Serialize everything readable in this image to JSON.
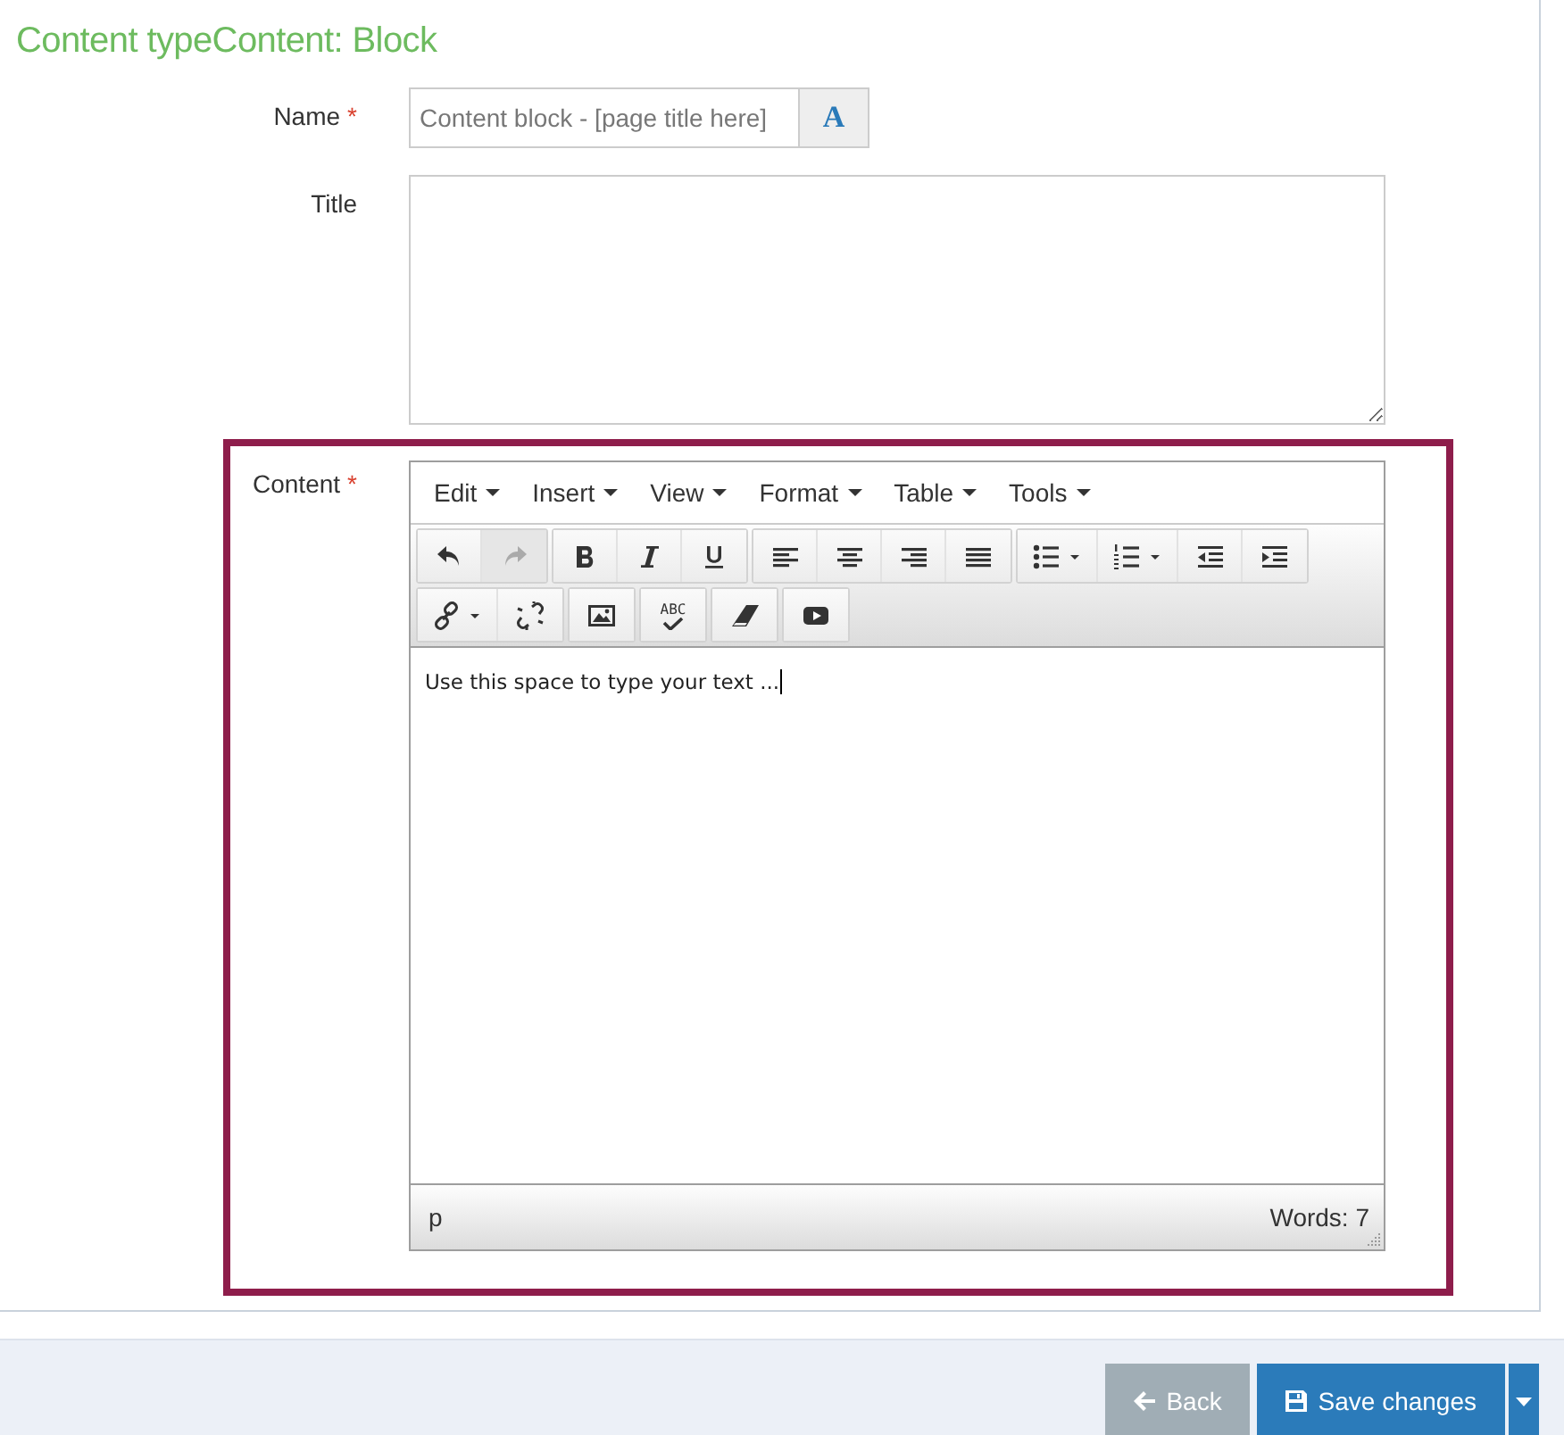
{
  "heading": "Content typeContent: Block",
  "fields": [
    {
      "label": "Name",
      "required_mark": "*",
      "kind": "text",
      "placeholder": "Content block - [page title here]",
      "addon": "A"
    },
    {
      "label": "Title",
      "kind": "textarea"
    }
  ],
  "editor": {
    "label": "Content",
    "required_mark": "*",
    "highlighted": true,
    "menus": [
      "Edit",
      "Insert",
      "View",
      "Format",
      "Table",
      "Tools"
    ],
    "toolbar_rows": [
      [
        [
          {
            "kind": "undo",
            "disabled": false
          },
          {
            "kind": "redo",
            "disabled": true
          }
        ],
        [
          {
            "kind": "bold",
            "disabled": false
          },
          {
            "kind": "italic",
            "disabled": false
          },
          {
            "kind": "underline",
            "disabled": false
          }
        ],
        [
          {
            "kind": "align-left",
            "disabled": false
          },
          {
            "kind": "align-center",
            "disabled": false
          },
          {
            "kind": "align-right",
            "disabled": false
          },
          {
            "kind": "justify",
            "disabled": false
          }
        ],
        [
          {
            "kind": "bullet-list",
            "disabled": false
          },
          {
            "kind": "numbered-list",
            "disabled": false
          },
          {
            "kind": "outdent",
            "disabled": false
          },
          {
            "kind": "indent",
            "disabled": false
          }
        ]
      ],
      [
        [
          {
            "kind": "link",
            "disabled": false
          },
          {
            "kind": "unlink",
            "disabled": false
          }
        ],
        [
          {
            "kind": "image",
            "disabled": false
          }
        ],
        [
          {
            "kind": "spellcheck",
            "disabled": false,
            "label": "ABC"
          }
        ],
        [
          {
            "kind": "eraser",
            "disabled": false
          }
        ],
        [
          {
            "kind": "video",
            "disabled": false
          }
        ]
      ]
    ],
    "text": "Use this space to type your text ...",
    "path": "p",
    "word_count": "Words: 7"
  },
  "footer": {
    "buttons": [
      {
        "label": "Back",
        "kind": "back"
      },
      {
        "label": "Save changes",
        "kind": "save"
      }
    ]
  }
}
